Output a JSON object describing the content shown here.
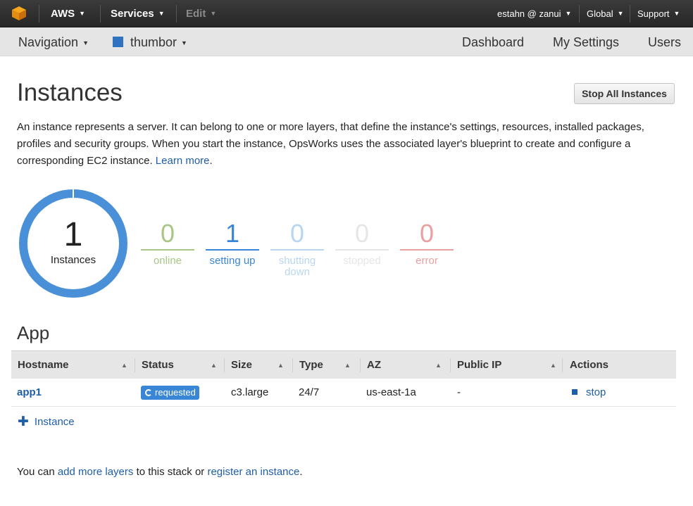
{
  "topbar": {
    "brand": "AWS",
    "services": "Services",
    "edit": "Edit",
    "user": "estahn @ zanui",
    "region": "Global",
    "support": "Support"
  },
  "navbar": {
    "navigation": "Navigation",
    "stack_name": "thumbor",
    "stack_color": "#2f73c0",
    "dashboard": "Dashboard",
    "my_settings": "My Settings",
    "users": "Users"
  },
  "page": {
    "title": "Instances",
    "stop_all_label": "Stop All Instances",
    "description": "An instance represents a server. It can belong to one or more layers, that define the instance's settings, resources, installed packages, profiles and security groups. When you start the instance, OpsWorks uses the associated layer's blueprint to create and configure a corresponding EC2 instance.",
    "learn_more": "Learn more",
    "period": "."
  },
  "summary": {
    "total": "1",
    "total_label": "Instances",
    "stats": [
      {
        "value": "0",
        "label": "online",
        "color": "#a8c686"
      },
      {
        "value": "1",
        "label": "setting up",
        "color": "#3a86d6"
      },
      {
        "value": "0",
        "label": "shutting down",
        "color": "#b9d6f0"
      },
      {
        "value": "0",
        "label": "stopped",
        "color": "#e6e6e6"
      },
      {
        "value": "0",
        "label": "error",
        "color": "#eaa0a0"
      }
    ]
  },
  "layer": {
    "name": "App",
    "columns": [
      "Hostname",
      "Status",
      "Size",
      "Type",
      "AZ",
      "Public IP",
      "Actions"
    ],
    "rows": [
      {
        "hostname": "app1",
        "status": "requested",
        "size": "c3.large",
        "type": "24/7",
        "az": "us-east-1a",
        "public_ip": "-",
        "action": "stop"
      }
    ],
    "add_instance": "Instance"
  },
  "footer": {
    "prefix": "You can ",
    "link1": "add more layers",
    "middle": " to this stack or ",
    "link2": "register an instance",
    "suffix": "."
  }
}
